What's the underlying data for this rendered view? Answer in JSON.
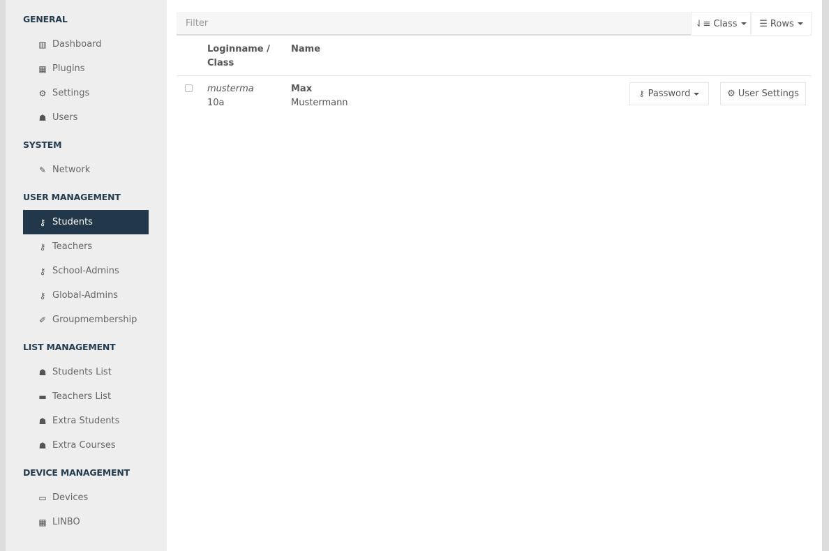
{
  "sidebar": {
    "sections": [
      {
        "title": "GENERAL",
        "items": [
          {
            "label": "Dashboard",
            "icon": "bar-chart-icon"
          },
          {
            "label": "Plugins",
            "icon": "grid-icon"
          },
          {
            "label": "Settings",
            "icon": "gear-icon"
          },
          {
            "label": "Users",
            "icon": "users-icon"
          }
        ]
      },
      {
        "title": "SYSTEM",
        "items": [
          {
            "label": "Network",
            "icon": "plug-icon"
          }
        ]
      },
      {
        "title": "USER MANAGEMENT",
        "items": [
          {
            "label": "Students",
            "icon": "key-icon",
            "active": true
          },
          {
            "label": "Teachers",
            "icon": "key-icon"
          },
          {
            "label": "School-Admins",
            "icon": "key-icon"
          },
          {
            "label": "Global-Admins",
            "icon": "key-icon"
          },
          {
            "label": "Groupmembership",
            "icon": "wrench-icon"
          }
        ]
      },
      {
        "title": "LIST MANAGEMENT",
        "items": [
          {
            "label": "Students List",
            "icon": "users-icon"
          },
          {
            "label": "Teachers List",
            "icon": "briefcase-icon"
          },
          {
            "label": "Extra Students",
            "icon": "users-icon"
          },
          {
            "label": "Extra Courses",
            "icon": "users-icon"
          }
        ]
      },
      {
        "title": "DEVICE MANAGEMENT",
        "items": [
          {
            "label": "Devices",
            "icon": "laptop-icon"
          },
          {
            "label": "LINBO",
            "icon": "grid-icon"
          }
        ]
      }
    ]
  },
  "toolbar": {
    "filter_placeholder": "Filter",
    "class_label": "Class",
    "rows_label": "Rows"
  },
  "table": {
    "headers": {
      "login": "Loginname /",
      "login2": "Class",
      "name": "Name"
    },
    "rows": [
      {
        "login": "musterma",
        "class": "10a",
        "first": "Max",
        "last": "Mustermann",
        "password_label": "Password",
        "settings_label": "User Settings"
      }
    ]
  }
}
